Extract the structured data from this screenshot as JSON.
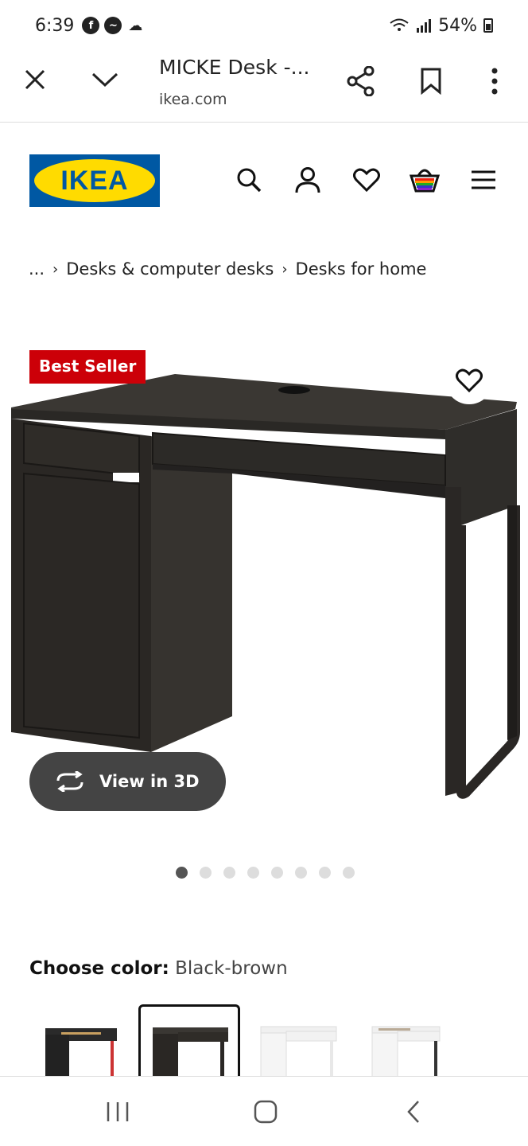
{
  "status": {
    "time": "6:39",
    "battery": "54%"
  },
  "browser": {
    "title": "MICKE Desk -...",
    "url": "ikea.com"
  },
  "logo": {
    "text": "IKEA"
  },
  "breadcrumb": {
    "ellipsis": "...",
    "items": [
      "Desks & computer desks",
      "Desks for home"
    ]
  },
  "product": {
    "badge": "Best Seller",
    "view3d_label": "View in 3D",
    "carousel": {
      "count": 8,
      "active": 0
    }
  },
  "color": {
    "label": "Choose color:",
    "value": "Black-brown"
  },
  "swatches": [
    {
      "name": "black-brown-red",
      "selected": false
    },
    {
      "name": "black-brown",
      "selected": true
    },
    {
      "name": "white",
      "selected": false
    },
    {
      "name": "white-anthracite",
      "selected": false
    }
  ],
  "colors": {
    "ikea_blue": "#0058a3",
    "ikea_yellow": "#ffdb00",
    "badge_red": "#cc0008"
  }
}
